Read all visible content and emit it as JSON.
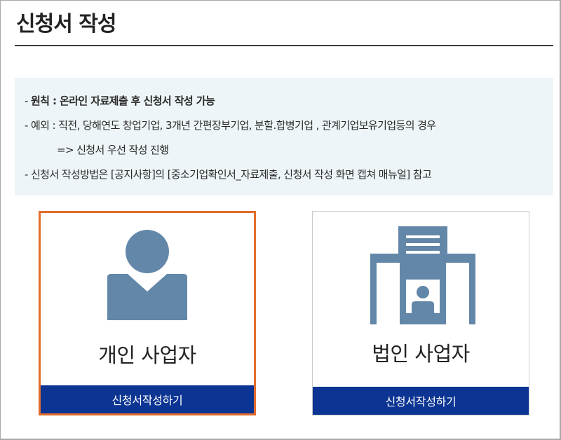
{
  "page": {
    "title": "신청서 작성"
  },
  "notice": {
    "principle_dash": "- ",
    "principle": "원칙 : 온라인 자료제출 후 신청서 작성 가능",
    "exception": "- 예외 : 직전, 당해연도 창업기업, 3개년 간편장부기업, 분할.합병기업 , 관계기업보유기업등의 경우",
    "exception_follow": "=> 신청서 우선 작성 진행",
    "method": "- 신청서 작성방법은 [공지사항]의 [중소기업확인서_자료제출, 신청서 작성 화면 캡쳐 매뉴얼] 참고"
  },
  "cards": [
    {
      "label": "개인 사업자",
      "button": "신청서작성하기",
      "icon": "person-icon"
    },
    {
      "label": "법인 사업자",
      "button": "신청서작성하기",
      "icon": "building-icon"
    }
  ],
  "colors": {
    "icon": "#6387a8",
    "button": "#0b3493",
    "selected_border": "#e36d2d",
    "notice_bg": "#eef5f8"
  }
}
